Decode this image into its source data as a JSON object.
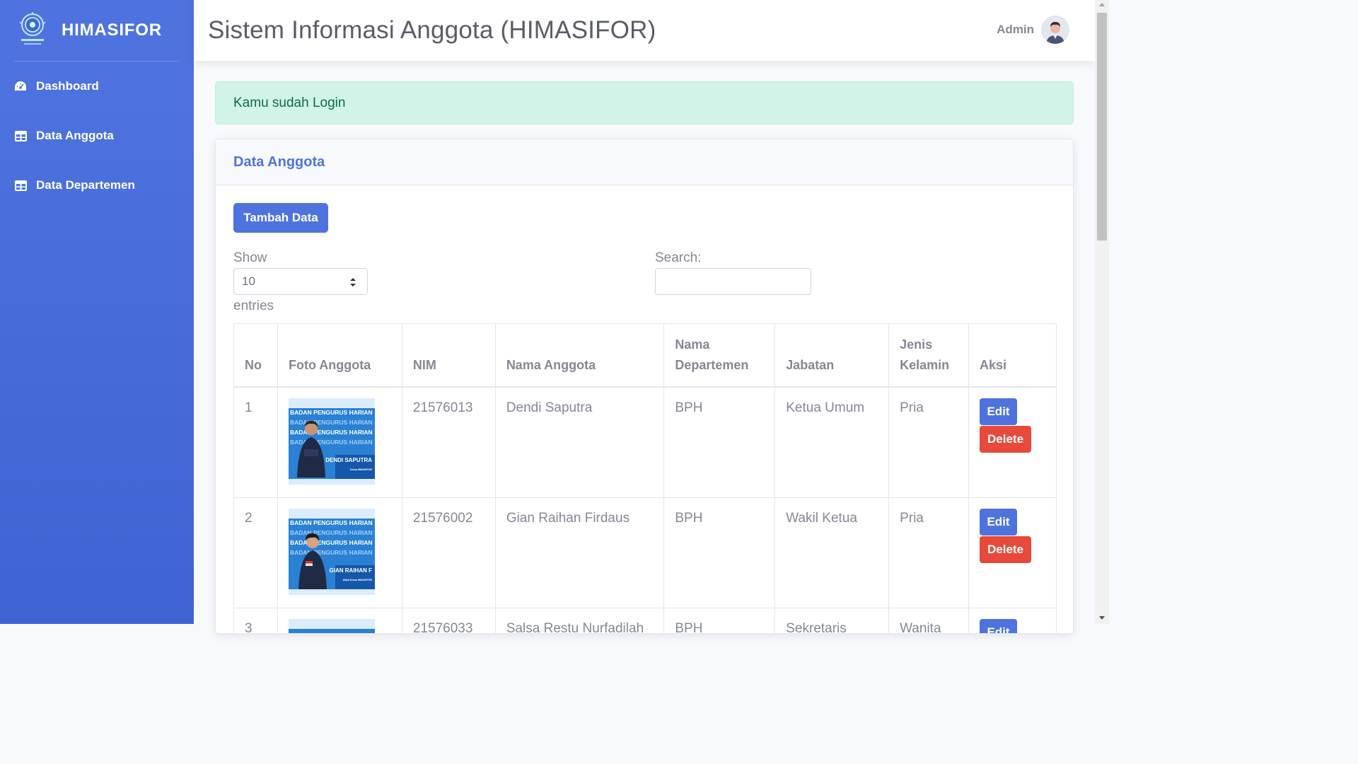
{
  "sidebar": {
    "brand": "HIMASIFOR",
    "items": [
      {
        "label": "Dashboard",
        "icon": "tachometer-icon"
      },
      {
        "label": "Data Anggota",
        "icon": "table-icon"
      },
      {
        "label": "Data Departemen",
        "icon": "table-icon"
      }
    ]
  },
  "topbar": {
    "title": "Sistem Informasi Anggota (HIMASIFOR)",
    "user": "Admin"
  },
  "alert": "Kamu sudah Login",
  "card": {
    "title": "Data Anggota",
    "add_button": "Tambah Data",
    "show_label": "Show",
    "show_value": "10",
    "entries_label": "entries",
    "search_label": "Search:",
    "search_value": ""
  },
  "table": {
    "headers": [
      "No",
      "Foto Anggota",
      "NIM",
      "Nama Anggota",
      "Nama Departemen",
      "Jabatan",
      "Jenis Kelamin",
      "Aksi"
    ],
    "rows": [
      {
        "no": "1",
        "photo_name": "DENDI SAPUTRA",
        "photo_role": "Ketua HIMASIFOR",
        "nim": "21576013",
        "nama": "Dendi Saputra",
        "departemen": "BPH",
        "jabatan": "Ketua Umum",
        "jk": "Pria"
      },
      {
        "no": "2",
        "photo_name": "GIAN RAIHAN F",
        "photo_role": "Wakil Ketua HIMASIFOR",
        "nim": "21576002",
        "nama": "Gian Raihan Firdaus",
        "departemen": "BPH",
        "jabatan": "Wakil Ketua",
        "jk": "Pria"
      },
      {
        "no": "3",
        "photo_name": "",
        "photo_role": "",
        "nim": "21576033",
        "nama": "Salsa Restu Nurfadilah",
        "departemen": "BPH",
        "jabatan": "Sekretaris",
        "jk": "Wanita"
      }
    ],
    "edit_label": "Edit",
    "delete_label": "Delete"
  },
  "poster_text": "BADAN PENGURUS HARIAN",
  "colors": {
    "primary": "#4e73df",
    "danger": "#e74a3b",
    "success_bg": "#d2f4e8",
    "success_text": "#0f6848"
  }
}
